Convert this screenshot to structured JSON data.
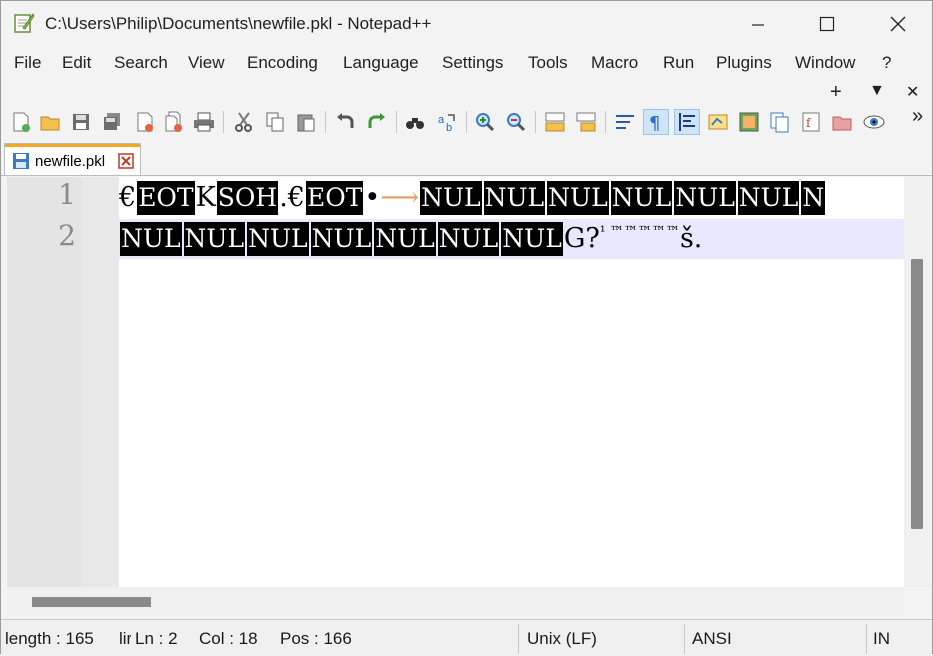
{
  "window": {
    "title": "C:\\Users\\Philip\\Documents\\newfile.pkl - Notepad++",
    "minimize": "—",
    "maximize": "☐",
    "close": "✕"
  },
  "menu": {
    "items": [
      "File",
      "Edit",
      "Search",
      "View",
      "Encoding",
      "Language",
      "Settings",
      "Tools",
      "Macro",
      "Run",
      "Plugins",
      "Window",
      "?"
    ],
    "plus": "+",
    "dropdown": "▼",
    "close_doc": "✕"
  },
  "toolbar": {
    "overflow": "»"
  },
  "tab": {
    "label": "newfile.pkl",
    "close": "✕"
  },
  "editor": {
    "line_numbers": [
      "1",
      "2"
    ],
    "line1": [
      {
        "kind": "txt",
        "text": "€"
      },
      {
        "kind": "ctl",
        "text": "EOT"
      },
      {
        "kind": "txt",
        "text": "K"
      },
      {
        "kind": "ctl",
        "text": "SOH"
      },
      {
        "kind": "txt",
        "text": ".€"
      },
      {
        "kind": "ctl",
        "text": "EOT"
      },
      {
        "kind": "txt",
        "text": "•"
      },
      {
        "kind": "arrow",
        "text": "⟶"
      },
      {
        "kind": "ctl",
        "text": "NUL"
      },
      {
        "kind": "ctl",
        "text": "NUL"
      },
      {
        "kind": "ctl",
        "text": "NUL"
      },
      {
        "kind": "ctl",
        "text": "NUL"
      },
      {
        "kind": "ctl",
        "text": "NUL"
      },
      {
        "kind": "ctl",
        "text": "NUL"
      },
      {
        "kind": "ctl",
        "text": "N"
      }
    ],
    "line2": [
      {
        "kind": "ctl",
        "text": "NUL"
      },
      {
        "kind": "ctl",
        "text": "NUL"
      },
      {
        "kind": "ctl",
        "text": "NUL"
      },
      {
        "kind": "ctl",
        "text": "NUL"
      },
      {
        "kind": "ctl",
        "text": "NUL"
      },
      {
        "kind": "ctl",
        "text": "NUL"
      },
      {
        "kind": "ctl",
        "text": "NUL"
      },
      {
        "kind": "txt",
        "text": "G?"
      },
      {
        "kind": "small",
        "text": "¹ ™™™™™"
      },
      {
        "kind": "txt",
        "text": "š."
      }
    ]
  },
  "status": {
    "length": "length : 165",
    "lines_trunc": "lir",
    "ln": "Ln : 2",
    "col": "Col : 18",
    "pos": "Pos : 166",
    "eol": "Unix (LF)",
    "encoding": "ANSI",
    "mode": "IN"
  },
  "colors": {
    "tab_accent": "#f5a623",
    "current_line": "#e8e8ff",
    "control_char_bg": "#000000",
    "tab_arrow": "#e49d61"
  }
}
